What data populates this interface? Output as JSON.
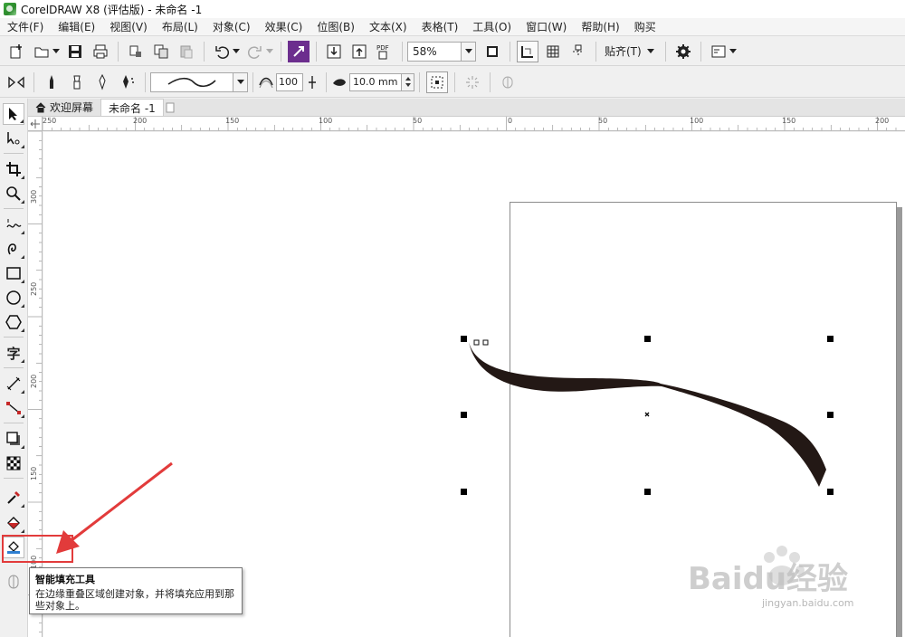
{
  "window": {
    "title": "CorelDRAW X8 (评估版) - 未命名 -1"
  },
  "menu": [
    "文件(F)",
    "编辑(E)",
    "视图(V)",
    "布局(L)",
    "对象(C)",
    "效果(C)",
    "位图(B)",
    "文本(X)",
    "表格(T)",
    "工具(O)",
    "窗口(W)",
    "帮助(H)",
    "购买"
  ],
  "toolbar": {
    "zoom_value": "58%",
    "pdf_label": "PDF",
    "snap_label": "贴齐(T)"
  },
  "property_bar": {
    "smoothing_value": "100",
    "width_value": "10.0 mm"
  },
  "tabs": {
    "welcome": "欢迎屏幕",
    "doc": "未命名 -1"
  },
  "ruler": {
    "h_labels": [
      "250",
      "200",
      "150",
      "100",
      "50",
      "0",
      "50",
      "100",
      "150",
      "200"
    ],
    "v_labels": [
      "300",
      "250",
      "200",
      "150",
      "100"
    ]
  },
  "tools": {
    "text_glyph": "字"
  },
  "tooltip": {
    "title": "智能填充工具",
    "description": "在边缘重叠区域创建对象，并将填充应用到那些对象上。"
  },
  "watermark": {
    "text": "Baidu经验",
    "url": "jingyan.baidu.com"
  },
  "colors": {
    "accent_red": "#e23b3b",
    "stroke_fill": "#231815"
  }
}
